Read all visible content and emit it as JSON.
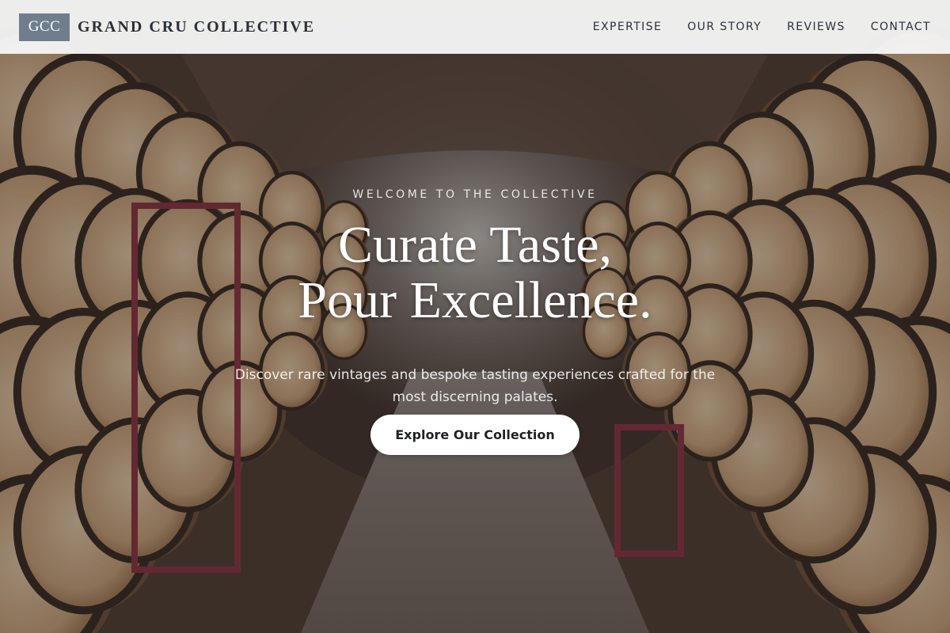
{
  "navbar": {
    "logo_mark": "GCC",
    "brand_name": "GRAND CRU COLLECTIVE",
    "links": [
      {
        "label": "EXPERTISE"
      },
      {
        "label": "OUR STORY"
      },
      {
        "label": "REVIEWS"
      },
      {
        "label": "CONTACT"
      }
    ]
  },
  "hero": {
    "eyebrow": "WELCOME TO THE COLLECTIVE",
    "headline_line1": "Curate Taste,",
    "headline_line2": "Pour Excellence.",
    "subtext": "Discover rare vintages and bespoke tasting experiences crafted for the most discerning palates.",
    "cta_label": "Explore Our Collection",
    "background_image": "wine-cellar-barrels-photo"
  },
  "colors": {
    "navbar_bg": "#f5f5f5",
    "logo_mark_bg": "#6f7d8c",
    "brand_text": "#2b3038",
    "cta_bg": "#ffffff",
    "cta_text": "#1f2126",
    "hero_text": "#ffffff"
  }
}
